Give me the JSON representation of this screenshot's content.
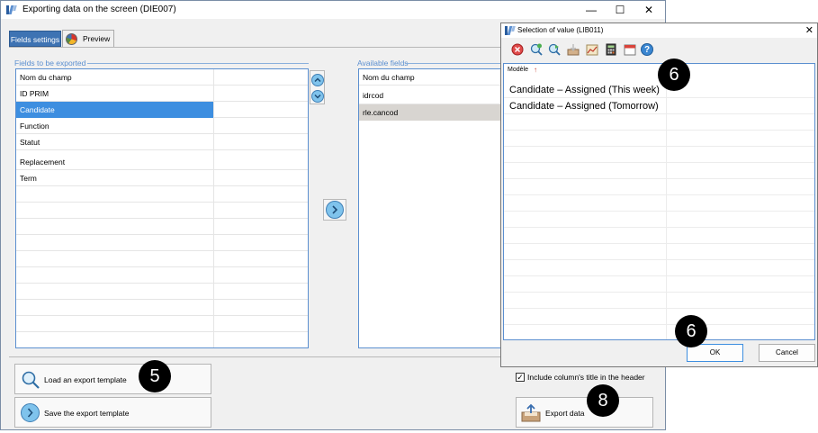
{
  "main_window": {
    "title": "Exporting data on the screen (DIE007)",
    "controls": {
      "minimize": "—",
      "maximize": "☐",
      "close": "✕"
    }
  },
  "tabs": [
    {
      "label": "Fields settings",
      "active": true
    },
    {
      "label": "Preview",
      "active": false
    }
  ],
  "fields_to_export": {
    "heading": "Fields to be exported",
    "rows": [
      "Nom du champ",
      "ID PRIM",
      "Candidate",
      "Function",
      "Statut",
      "Replacement",
      "Term"
    ],
    "selected_index": 2
  },
  "available_fields": {
    "heading": "Available fields",
    "rows": [
      "Nom du champ",
      "idrcod",
      "rle.cancod"
    ],
    "highlighted_index": 2
  },
  "buttons": {
    "move_up_icon": "chevron-up",
    "move_down_icon": "chevron-down",
    "transfer_icon": "chevron-right",
    "load_template": "Load an export template",
    "save_template": "Save the export template",
    "export_data": "Export data"
  },
  "include_titles": {
    "label": "Include column's title in the header",
    "checked": true,
    "mark": "✓"
  },
  "dialog": {
    "title": "Selection of value (LIB011)",
    "close": "✕",
    "toolbar_icons": [
      "cancel-icon",
      "search-add-icon",
      "search-back-icon",
      "import-icon",
      "chart-icon",
      "calculator-icon",
      "calendar-icon",
      "help-icon"
    ],
    "help_glyph": "?",
    "column_header": "Modèle",
    "column_sort_glyph": "↑",
    "rows": [
      "Candidate – Assigned (This week)",
      "Candidate – Assigned (Tomorrow)"
    ],
    "ok_label": "OK",
    "cancel_label": "Cancel"
  },
  "annotations": [
    "5",
    "6",
    "6",
    "8"
  ],
  "colors": {
    "accent_blue": "#3e73b3",
    "selection_blue": "#3d8ee0",
    "border_blue": "#5b8fd0",
    "highlight_gray": "#d8d5d1"
  }
}
